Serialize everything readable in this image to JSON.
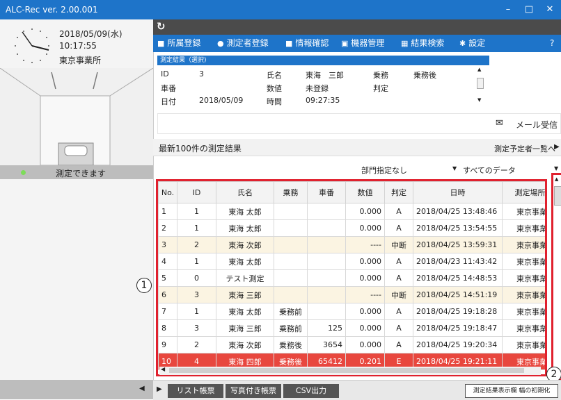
{
  "window": {
    "title": "ALC-Rec  ver. 2.00.001",
    "minimize": "–",
    "maximize": "□",
    "close": "✕"
  },
  "clock": {
    "date": "2018/05/09(水)",
    "time": "10:17:55",
    "office": "東京事業所"
  },
  "status": {
    "text": "測定できます",
    "color": "#7ddc59"
  },
  "nav": {
    "items": [
      {
        "icon": "building-icon",
        "label": "所属登録"
      },
      {
        "icon": "person-icon",
        "label": "測定者登録"
      },
      {
        "icon": "info-card-icon",
        "label": "情報確認"
      },
      {
        "icon": "device-icon",
        "label": "機器管理"
      },
      {
        "icon": "calendar-icon",
        "label": "結果検索"
      },
      {
        "icon": "gear-icon",
        "label": "設定"
      }
    ],
    "help": "?"
  },
  "selection": {
    "header": "測定結果（選択)",
    "id_label": "ID",
    "id_value": "3",
    "name_label": "氏名",
    "name_value": "東海　三郎",
    "duty_label": "乗務",
    "duty_value": "乗務後",
    "car_label": "車番",
    "car_value": "",
    "value_label": "数値",
    "value_value": "未登録",
    "judge_label": "判定",
    "judge_value": "",
    "date_label": "日付",
    "date_value": "2018/05/09",
    "time_label": "時間",
    "time_value": "09:27:35"
  },
  "mail": {
    "label": "メール受信"
  },
  "section": {
    "title": "最新100件の測定結果",
    "link": "測定予定者一覧へ"
  },
  "filters": {
    "department": "部門指定なし",
    "data_scope": "すべてのデータ"
  },
  "table": {
    "headers": [
      "No.",
      "ID",
      "氏名",
      "乗務",
      "車番",
      "数値",
      "判定",
      "日時",
      "測定場所"
    ],
    "rows": [
      {
        "no": "1",
        "id": "1",
        "name": "東海 太郎",
        "duty": "",
        "car": "",
        "value": "0.000",
        "judge": "A",
        "datetime": "2018/04/25 13:48:46",
        "place": "東京事業所",
        "style": ""
      },
      {
        "no": "2",
        "id": "1",
        "name": "東海 太郎",
        "duty": "",
        "car": "",
        "value": "0.000",
        "judge": "A",
        "datetime": "2018/04/25 13:54:55",
        "place": "東京事業所",
        "style": ""
      },
      {
        "no": "3",
        "id": "2",
        "name": "東海 次郎",
        "duty": "",
        "car": "",
        "value": "----",
        "judge": "中断",
        "datetime": "2018/04/25 13:59:31",
        "place": "東京事業所",
        "style": "alt"
      },
      {
        "no": "4",
        "id": "1",
        "name": "東海 太郎",
        "duty": "",
        "car": "",
        "value": "0.000",
        "judge": "A",
        "datetime": "2018/04/23 11:43:42",
        "place": "東京事業所",
        "style": ""
      },
      {
        "no": "5",
        "id": "0",
        "name": "テスト測定",
        "duty": "",
        "car": "",
        "value": "0.000",
        "judge": "A",
        "datetime": "2018/04/25 14:48:53",
        "place": "東京事業所",
        "style": ""
      },
      {
        "no": "6",
        "id": "3",
        "name": "東海 三郎",
        "duty": "",
        "car": "",
        "value": "----",
        "judge": "中断",
        "datetime": "2018/04/25 14:51:19",
        "place": "東京事業所",
        "style": "alt"
      },
      {
        "no": "7",
        "id": "1",
        "name": "東海 太郎",
        "duty": "乗務前",
        "car": "",
        "value": "0.000",
        "judge": "A",
        "datetime": "2018/04/25 19:18:28",
        "place": "東京事業所",
        "style": ""
      },
      {
        "no": "8",
        "id": "3",
        "name": "東海 三郎",
        "duty": "乗務前",
        "car": "125",
        "value": "0.000",
        "judge": "A",
        "datetime": "2018/04/25 19:18:47",
        "place": "東京事業所",
        "style": ""
      },
      {
        "no": "9",
        "id": "2",
        "name": "東海 次郎",
        "duty": "乗務後",
        "car": "3654",
        "value": "0.000",
        "judge": "A",
        "datetime": "2018/04/25 19:20:34",
        "place": "東京事業所",
        "style": ""
      },
      {
        "no": "10",
        "id": "4",
        "name": "東海 四郎",
        "duty": "乗務後",
        "car": "65412",
        "value": "0.201",
        "judge": "E",
        "datetime": "2018/04/25 19:21:11",
        "place": "東京事業所",
        "style": "err"
      }
    ]
  },
  "bottom": {
    "list_report": "リスト帳票",
    "photo_report": "写真付き帳票",
    "csv": "CSV出力",
    "reset_width": "測定結果表示欄 幅の初期化"
  },
  "callouts": {
    "one": "1",
    "two": "2"
  },
  "colors": {
    "accent": "#1e74c9",
    "error_row": "#e8473e",
    "alt_row": "#fbf4e2",
    "highlight": "#e0212e"
  }
}
